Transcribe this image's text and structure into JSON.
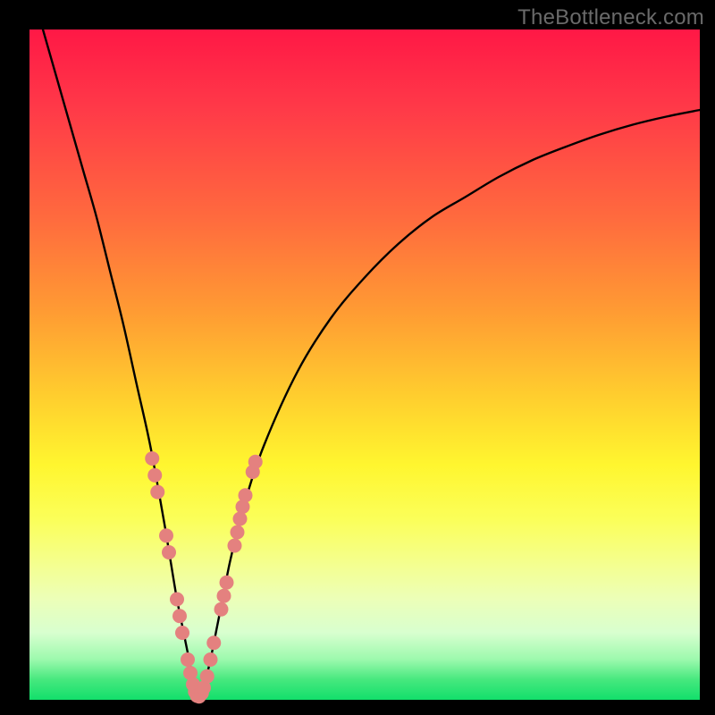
{
  "watermark": "TheBottleneck.com",
  "chart_data": {
    "type": "line",
    "title": "",
    "xlabel": "",
    "ylabel": "",
    "xlim": [
      0,
      100
    ],
    "ylim": [
      0,
      100
    ],
    "curve": {
      "name": "bottleneck-percentage",
      "x": [
        2,
        4,
        6,
        8,
        10,
        12,
        14,
        16,
        18,
        20,
        21,
        22,
        23,
        24,
        24.7,
        25.3,
        26,
        27,
        28,
        29,
        30,
        32,
        35,
        40,
        45,
        50,
        55,
        60,
        65,
        70,
        75,
        80,
        85,
        90,
        95,
        100
      ],
      "y_pct": [
        100,
        93,
        86,
        79,
        72,
        64,
        56,
        47,
        38,
        27,
        21,
        15,
        10,
        5,
        1,
        0.5,
        2,
        6,
        11,
        16,
        21,
        29,
        38,
        49,
        57,
        63,
        68,
        72,
        75,
        78,
        80.5,
        82.5,
        84.3,
        85.8,
        87,
        88
      ]
    },
    "highlight_segments": {
      "name": "marker-dots",
      "color": "#e4817f",
      "points": [
        {
          "x": 18.3,
          "y_pct": 36
        },
        {
          "x": 18.7,
          "y_pct": 33.5
        },
        {
          "x": 19.1,
          "y_pct": 31
        },
        {
          "x": 20.4,
          "y_pct": 24.5
        },
        {
          "x": 20.8,
          "y_pct": 22
        },
        {
          "x": 22.0,
          "y_pct": 15
        },
        {
          "x": 22.4,
          "y_pct": 12.5
        },
        {
          "x": 22.8,
          "y_pct": 10
        },
        {
          "x": 23.6,
          "y_pct": 6
        },
        {
          "x": 24.0,
          "y_pct": 4
        },
        {
          "x": 24.4,
          "y_pct": 2.3
        },
        {
          "x": 24.7,
          "y_pct": 1.2
        },
        {
          "x": 25.0,
          "y_pct": 0.6
        },
        {
          "x": 25.3,
          "y_pct": 0.5
        },
        {
          "x": 25.7,
          "y_pct": 1.0
        },
        {
          "x": 26.0,
          "y_pct": 1.8
        },
        {
          "x": 26.5,
          "y_pct": 3.5
        },
        {
          "x": 27.0,
          "y_pct": 6
        },
        {
          "x": 27.5,
          "y_pct": 8.5
        },
        {
          "x": 28.6,
          "y_pct": 13.5
        },
        {
          "x": 29.0,
          "y_pct": 15.5
        },
        {
          "x": 29.4,
          "y_pct": 17.5
        },
        {
          "x": 30.6,
          "y_pct": 23
        },
        {
          "x": 31.0,
          "y_pct": 25
        },
        {
          "x": 31.4,
          "y_pct": 27
        },
        {
          "x": 31.8,
          "y_pct": 28.8
        },
        {
          "x": 32.2,
          "y_pct": 30.5
        },
        {
          "x": 33.3,
          "y_pct": 34
        },
        {
          "x": 33.7,
          "y_pct": 35.5
        }
      ]
    },
    "gradient_stops": [
      {
        "pct": 0,
        "color": "#ff1846"
      },
      {
        "pct": 12,
        "color": "#ff3a48"
      },
      {
        "pct": 28,
        "color": "#ff6a3e"
      },
      {
        "pct": 42,
        "color": "#ff9b33"
      },
      {
        "pct": 55,
        "color": "#ffcf2e"
      },
      {
        "pct": 65,
        "color": "#fff62f"
      },
      {
        "pct": 73,
        "color": "#fbff59"
      },
      {
        "pct": 80,
        "color": "#f4ff91"
      },
      {
        "pct": 85,
        "color": "#ecffb8"
      },
      {
        "pct": 90,
        "color": "#d8ffcf"
      },
      {
        "pct": 94,
        "color": "#9cf9ad"
      },
      {
        "pct": 97,
        "color": "#46e87e"
      },
      {
        "pct": 100,
        "color": "#12df6b"
      }
    ]
  }
}
